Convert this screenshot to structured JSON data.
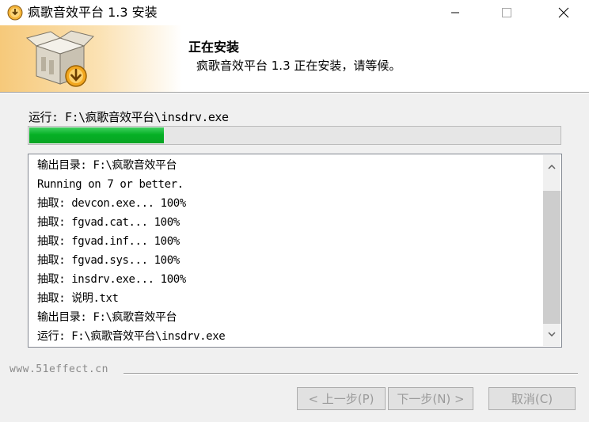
{
  "window": {
    "title": "疯歌音效平台 1.3 安装",
    "minimize_icon": "minimize-icon",
    "maximize_icon": "maximize-icon",
    "close_icon": "close-icon"
  },
  "header": {
    "title": "正在安装",
    "subtitle": "疯歌音效平台 1.3 正在安装，请等候。",
    "image_icon": "installer-box-icon"
  },
  "status": {
    "text": "运行: F:\\疯歌音效平台\\insdrv.exe",
    "progress": 0.254,
    "progress_color": "#06b025"
  },
  "log": {
    "lines": [
      "输出目录: F:\\疯歌音效平台",
      "Running on 7 or better.",
      "抽取: devcon.exe... 100%",
      "抽取: fgvad.cat... 100%",
      "抽取: fgvad.inf... 100%",
      "抽取: fgvad.sys... 100%",
      "抽取: insdrv.exe... 100%",
      "抽取: 说明.txt",
      "输出目录: F:\\疯歌音效平台",
      "运行: F:\\疯歌音效平台\\insdrv.exe"
    ]
  },
  "footer": {
    "brand": "www.51effect.cn",
    "back_label": "< 上一步(P)",
    "next_label": "下一步(N) >",
    "cancel_label": "取消(C)"
  }
}
